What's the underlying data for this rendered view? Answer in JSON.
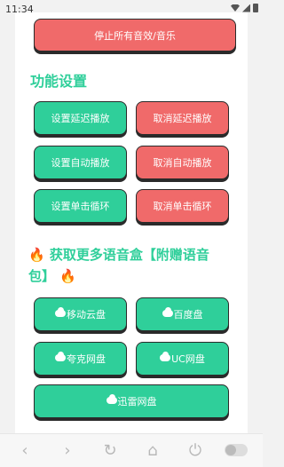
{
  "status": {
    "time": "11:34"
  },
  "buttons": {
    "stop_all": "停止所有音效/音乐",
    "set_delay": "设置延迟播放",
    "cancel_delay": "取消延迟播放",
    "set_auto": "设置自动播放",
    "cancel_auto": "取消自动播放",
    "set_loop": "设置单击循环",
    "cancel_loop": "取消单击循环"
  },
  "sections": {
    "settings_title": "功能设置",
    "more_title_line1": "获取更多语音盒【附赠语音",
    "more_title_line2": "包】"
  },
  "downloads": {
    "mobile_cloud": "移动云盘",
    "baidu": "百度盘",
    "quark": "夸克网盘",
    "uc": "UC网盘",
    "xunlei": "迅雷网盘"
  },
  "icons": {
    "fire": "🔥",
    "cloud": "cloud-icon"
  },
  "colors": {
    "accent_green": "#2fcf9a",
    "danger_red": "#f06a6a"
  }
}
